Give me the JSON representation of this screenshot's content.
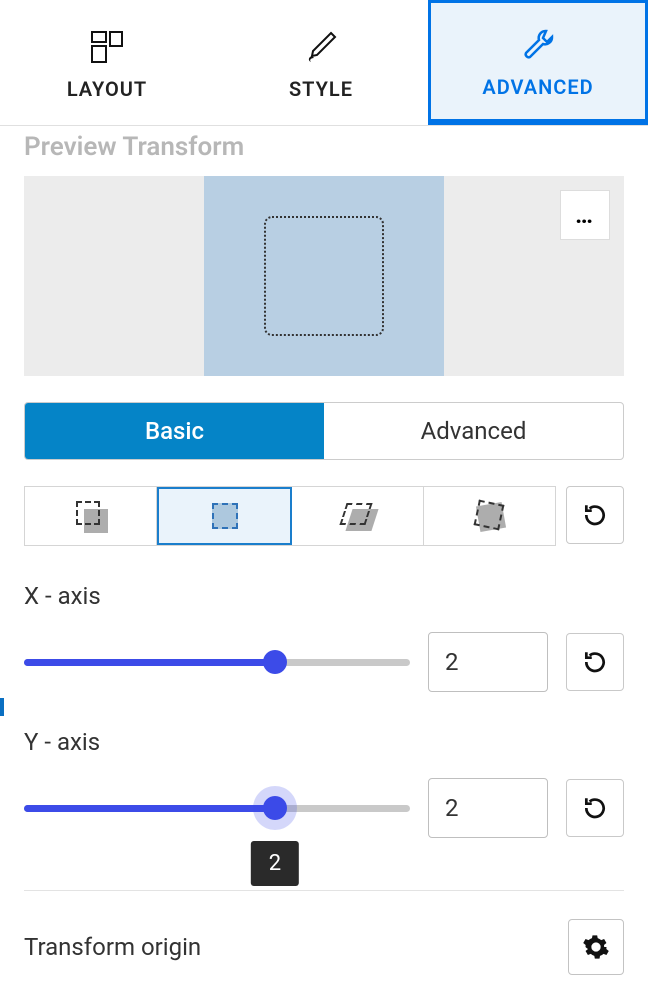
{
  "tabs": {
    "layout": "LAYOUT",
    "style": "STYLE",
    "advanced": "ADVANCED"
  },
  "preview_title": "Preview Transform",
  "more_label": "…",
  "segmented": {
    "basic": "Basic",
    "advanced": "Advanced"
  },
  "axes": {
    "x_label": "X - axis",
    "x_value": "2",
    "y_label": "Y - axis",
    "y_value": "2",
    "y_tooltip": "2"
  },
  "origin_label": "Transform origin"
}
